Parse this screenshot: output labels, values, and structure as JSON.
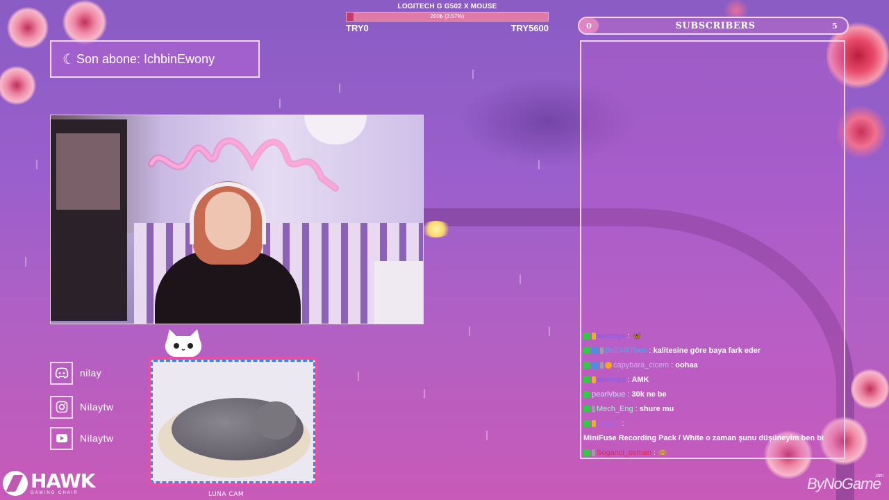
{
  "goal": {
    "title": "LOGITECH G G502 X MOUSE",
    "progress_text": "200₺ (3.57%)",
    "progress": 0.0357,
    "start": "TRY0",
    "end": "TRY5600"
  },
  "subscribers": {
    "current": "0",
    "label": "SUBSCRIBERS",
    "goal": "5"
  },
  "latest_sub": {
    "text": "Son abone: IchbinEwony"
  },
  "socials": [
    {
      "icon": "discord-icon",
      "label": "nilay"
    },
    {
      "icon": "instagram-icon",
      "label": "Nilaytw"
    },
    {
      "icon": "youtube-icon",
      "label": "Nilaytw"
    }
  ],
  "petcam": {
    "label": "LUNA CAM"
  },
  "chat": [
    {
      "user": "womnys",
      "color": "#7a5cf0",
      "badges": [
        "k",
        "n"
      ],
      "msg": "🦋"
    },
    {
      "user": "BoZARTben",
      "color": "#4fa8f0",
      "badges": [
        "k",
        "b",
        "g"
      ],
      "msg": "kalitesine göre baya fark eder"
    },
    {
      "user": "capybara_cicem",
      "color": "#c9b3e8",
      "badges": [
        "k",
        "b",
        "g",
        "o"
      ],
      "msg": "oohaa"
    },
    {
      "user": "womnys",
      "color": "#7a5cf0",
      "badges": [
        "k",
        "n"
      ],
      "msg": "AMK"
    },
    {
      "user": "pearlvbue",
      "color": "#bfe3ff",
      "badges": [
        "k"
      ],
      "msg": "30k ne be"
    },
    {
      "user": "Mech_Eng",
      "color": "#aef0d0",
      "badges": [
        "k",
        "g"
      ],
      "msg": "shure mu"
    },
    {
      "user": "oizq01",
      "color": "#9a6cf0",
      "badges": [
        "k",
        "n"
      ],
      "msg": "MiniFuse Recording Pack / White o zaman şunu düşüneyim ben bi"
    },
    {
      "user": "Soganci_osman",
      "color": "#e02a4a",
      "badges": [
        "k",
        "g"
      ],
      "msg": "🙈"
    }
  ],
  "brand": {
    "name": "HAWK",
    "sub": "GAMING CHAIR",
    "watermark": "ByNoGame",
    "watermark_sup": ".com"
  },
  "colors": {
    "frame": "#f3d8ec",
    "goal_fill": "#c23a6e",
    "petcam_border": "#e84ea4"
  }
}
